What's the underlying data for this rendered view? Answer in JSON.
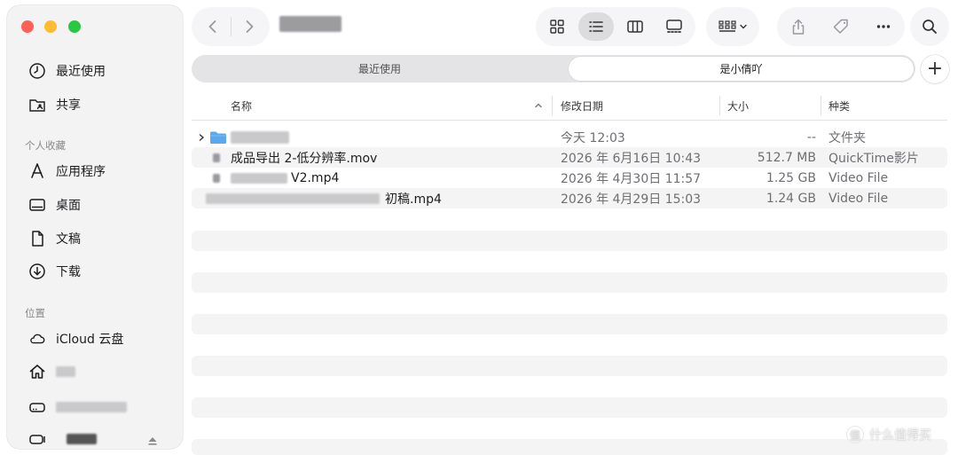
{
  "sidebar": {
    "favorites": [
      {
        "label": "最近使用",
        "icon": "clock-icon"
      },
      {
        "label": "共享",
        "icon": "shared-folder-icon"
      }
    ],
    "personal_heading": "个人收藏",
    "personal": [
      {
        "label": "应用程序",
        "icon": "applications-icon"
      },
      {
        "label": "桌面",
        "icon": "desktop-icon"
      },
      {
        "label": "文稿",
        "icon": "document-icon"
      },
      {
        "label": "下载",
        "icon": "download-icon"
      }
    ],
    "locations_heading": "位置",
    "locations": [
      {
        "label": "iCloud 云盘",
        "icon": "cloud-icon"
      },
      {
        "label": "",
        "icon": "home-icon"
      },
      {
        "label": "",
        "icon": "drive-icon"
      },
      {
        "label": "",
        "icon": "external-drive-icon"
      }
    ]
  },
  "toolbar": {
    "view_modes": [
      "icon-view",
      "list-view",
      "column-view",
      "gallery-view"
    ],
    "selected_view": "list-view"
  },
  "tabs": [
    {
      "label": "最近使用",
      "active": false
    },
    {
      "label": "是小倩吖",
      "active": true
    }
  ],
  "columns": {
    "name": "名称",
    "modified": "修改日期",
    "size": "大小",
    "kind": "种类"
  },
  "files": [
    {
      "name": "",
      "modified": "今天 12:03",
      "size": "--",
      "kind": "文件夹",
      "is_folder": true
    },
    {
      "name": "成品导出 2-低分辨率.mov",
      "modified": "2026 年 6月16日 10:43",
      "size": "512.7 MB",
      "kind": "QuickTime影片"
    },
    {
      "name": "V2.mp4",
      "modified": "2026 年 4月30日 11:57",
      "size": "1.25 GB",
      "kind": "Video File"
    },
    {
      "name": "初稿.mp4",
      "modified": "2026 年 4月29日 15:03",
      "size": "1.24 GB",
      "kind": "Video File"
    }
  ],
  "watermark": "什么值得买",
  "colors": {
    "close": "#fe5f57",
    "minimize": "#febc2e",
    "zoom": "#28c840",
    "folder": "#5aa9f0"
  }
}
